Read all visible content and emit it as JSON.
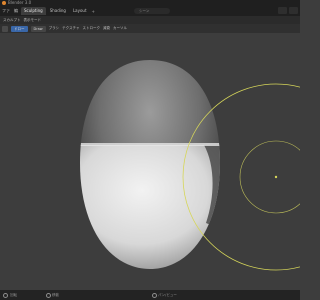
{
  "window": {
    "title": "Blender [C:\\Users\\...\\head.blend]",
    "title_visible": "Blender 3.0"
  },
  "menu": {
    "items": [
      "ファ",
      "編",
      "レ",
      "ウ",
      "ヘ"
    ],
    "tabs": [
      {
        "label": "Sculpting",
        "active": true
      },
      {
        "label": "Shading",
        "active": false
      },
      {
        "label": "Layout",
        "active": false
      }
    ],
    "add_tab": "+",
    "search_placeholder": "シーン"
  },
  "header": {
    "mode_label": "スカルプト",
    "mode_value": "表示モード"
  },
  "toolbar": {
    "brush_chip": "ドロー",
    "brush_chip2": "Draw",
    "labels": [
      "ブラシ",
      "テクスチャ",
      "ストローク",
      "減衰",
      "カーソル"
    ]
  },
  "status": {
    "left": "回転",
    "mid": "移動",
    "mid2": "パン/ビュー"
  },
  "colors": {
    "brush_circle": "#d6d65a",
    "viewport_bg": "#3d3d3d",
    "accent_blue": "#3a67a8"
  }
}
